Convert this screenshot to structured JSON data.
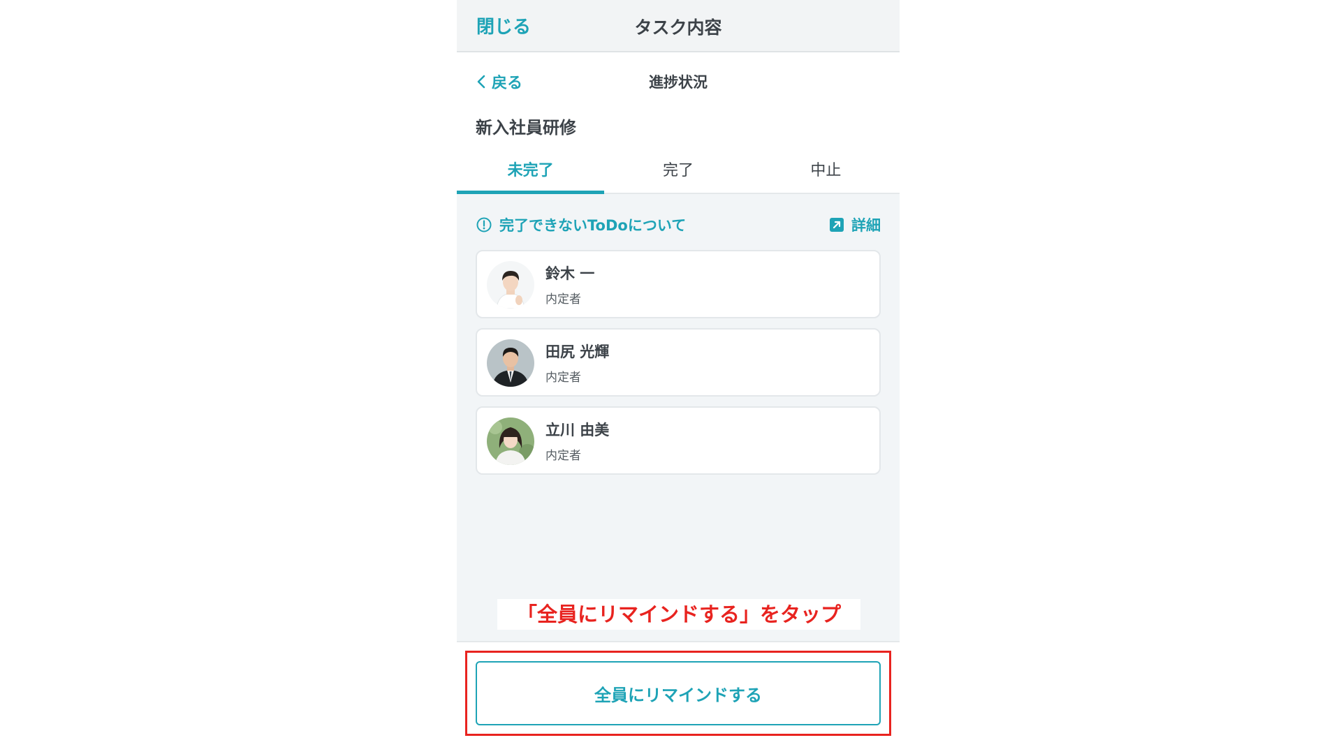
{
  "header": {
    "close_label": "閉じる",
    "title": "タスク内容"
  },
  "subnav": {
    "back_label": "戻る",
    "title": "進捗状況"
  },
  "course": {
    "title": "新入社員研修"
  },
  "tabs": [
    {
      "label": "未完了",
      "active": true
    },
    {
      "label": "完了",
      "active": false
    },
    {
      "label": "中止",
      "active": false
    }
  ],
  "notice": {
    "text": "完了できないToDoについて",
    "detail_label": "詳細"
  },
  "users": [
    {
      "name": "鈴木 一",
      "role": "内定者",
      "avatar": "avatar-man-white-shirt"
    },
    {
      "name": "田尻 光輝",
      "role": "内定者",
      "avatar": "avatar-man-suit"
    },
    {
      "name": "立川 由美",
      "role": "内定者",
      "avatar": "avatar-woman"
    }
  ],
  "instruction": "「全員にリマインドする」をタップ",
  "actions": {
    "remind_all_label": "全員にリマインドする"
  },
  "colors": {
    "accent": "#1ea3b6",
    "annotation": "#e8231f",
    "content_bg": "#f2f5f7",
    "header_bg": "#f2f4f5"
  }
}
